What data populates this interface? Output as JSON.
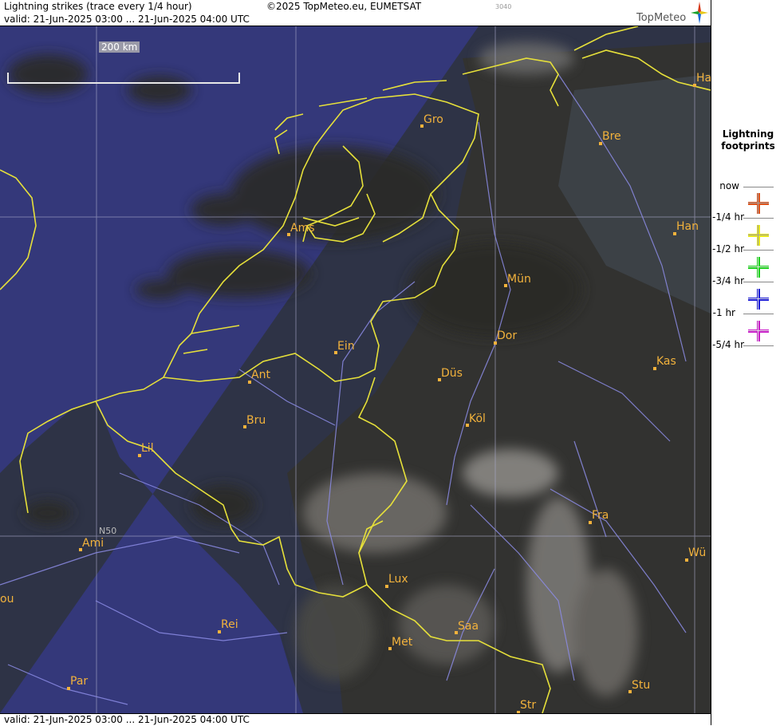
{
  "header": {
    "title": "Lightning strikes (trace every 1/4 hour)",
    "valid": "valid:  21-Jun-2025 03:00 ... 21-Jun-2025 04:00 UTC",
    "copyright": "©2025 TopMeteo.eu, EUMETSAT",
    "code": "3040",
    "logo_text": "TopMeteo"
  },
  "footer": {
    "valid": "valid:  21-Jun-2025 03:00 ... 21-Jun-2025 04:00 UTC"
  },
  "map": {
    "scale_label": "200 km",
    "gridline_label": "N50",
    "cities": [
      {
        "name": "Gro"
      },
      {
        "name": "Bre"
      },
      {
        "name": "Ha"
      },
      {
        "name": "Ams"
      },
      {
        "name": "Han"
      },
      {
        "name": "Mün"
      },
      {
        "name": "Dor"
      },
      {
        "name": "Ein"
      },
      {
        "name": "Ant"
      },
      {
        "name": "Düs"
      },
      {
        "name": "Kas"
      },
      {
        "name": "Bru"
      },
      {
        "name": "Köl"
      },
      {
        "name": "Lil"
      },
      {
        "name": "Fra"
      },
      {
        "name": "Ami"
      },
      {
        "name": "Wü"
      },
      {
        "name": "Lux"
      },
      {
        "name": "ou"
      },
      {
        "name": "Rei"
      },
      {
        "name": "Saa"
      },
      {
        "name": "Met"
      },
      {
        "name": "Par"
      },
      {
        "name": "Stu"
      },
      {
        "name": "Str"
      }
    ],
    "colors": {
      "sea": "#34387a",
      "land_dark": "#2d2d2a",
      "border": "#e6e03a",
      "river": "#8c8ce6",
      "city": "#f2b23c"
    }
  },
  "legend": {
    "title_line1": "Lightning",
    "title_line2": "footprints",
    "items": [
      {
        "label": "now",
        "color": "#e0531a",
        "icon": "cross-icon"
      },
      {
        "label": "-1/4 hr",
        "color": "#e8e81a",
        "icon": "cross-icon"
      },
      {
        "label": "-1/2 hr",
        "color": "#1ad21a",
        "icon": "cross-icon"
      },
      {
        "label": "-3/4 hr",
        "color": "#1a1ad6",
        "icon": "cross-icon"
      },
      {
        "label": "-1 hr",
        "color": "#c81ac8",
        "icon": "cross-icon"
      },
      {
        "label": "-5/4 hr",
        "color": "",
        "icon": ""
      }
    ]
  }
}
